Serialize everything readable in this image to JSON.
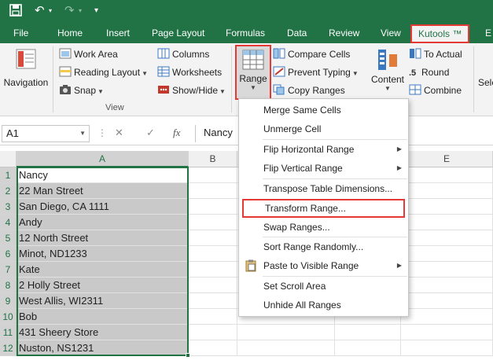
{
  "qat": {
    "save_icon": "save-icon",
    "undo_icon": "undo-icon",
    "redo_icon": "redo-icon",
    "customize_icon": "customize-qat-icon"
  },
  "tabs": [
    "File",
    "Home",
    "Insert",
    "Page Layout",
    "Formulas",
    "Data",
    "Review",
    "View",
    "Kutools ™",
    "E"
  ],
  "ribbon": {
    "navigation": "Navigation",
    "work_area": "Work Area",
    "reading_layout": "Reading Layout",
    "snap": "Snap",
    "columns": "Columns",
    "worksheets": "Worksheets",
    "show_hide": "Show/Hide",
    "view_group": "View",
    "range": "Range",
    "compare_cells": "Compare Cells",
    "prevent_typing": "Prevent Typing",
    "copy_ranges": "Copy Ranges",
    "content": "Content",
    "to_actual": "To Actual",
    "round": "Round",
    "combine": "Combine",
    "sele": "Sele",
    "accent": "#217346",
    "highlight": "#e53935"
  },
  "formula_bar": {
    "name_box": "A1",
    "cancel": "✕",
    "enter": "✓",
    "fx": "fx",
    "value": "Nancy"
  },
  "columns": [
    "A",
    "B",
    "C",
    "D",
    "E"
  ],
  "rows": [
    "1",
    "2",
    "3",
    "4",
    "5",
    "6",
    "7",
    "8",
    "9",
    "10",
    "11",
    "12"
  ],
  "cells_a": [
    "Nancy",
    "22 Man Street",
    "San Diego, CA 1111",
    "Andy",
    "12 North Street",
    "Minot, ND1233",
    "Kate",
    "2 Holly Street",
    "West Allis, WI2311",
    "Bob",
    "431 Sheery Store",
    "Nuston, NS1231"
  ],
  "menu": [
    "Merge Same Cells",
    "Unmerge Cell",
    "Flip Horizontal Range",
    "Flip Vertical Range",
    "Transpose Table Dimensions...",
    "Transform Range...",
    "Swap Ranges...",
    "Sort Range Randomly...",
    "Paste to Visible Range",
    "Set Scroll Area",
    "Unhide All Ranges"
  ]
}
